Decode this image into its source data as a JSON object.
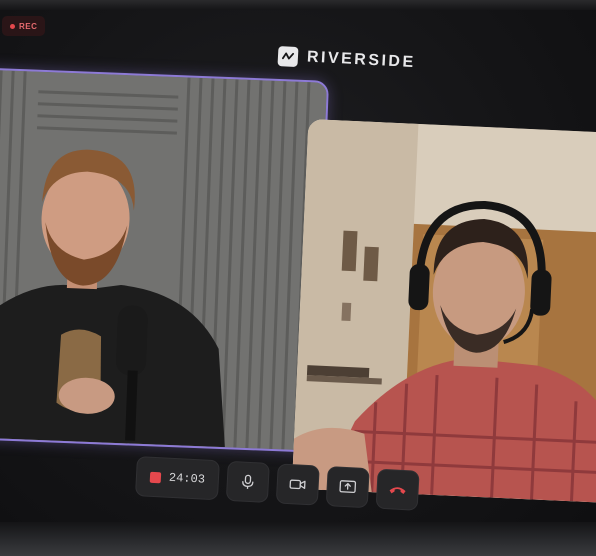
{
  "recording": {
    "badge_label": "REC"
  },
  "brand": {
    "name": "RIVERSIDE"
  },
  "controls": {
    "timer": "24:03",
    "items": [
      {
        "icon": "stop-record-icon"
      },
      {
        "icon": "microphone-icon"
      },
      {
        "icon": "camera-icon"
      },
      {
        "icon": "share-screen-icon"
      },
      {
        "icon": "end-call-icon"
      }
    ]
  },
  "colors": {
    "background": "#151517",
    "active_speaker_border": "#8d7ad6",
    "record": "#e5484d",
    "end_call": "#e5484d",
    "control_bg": "#262628"
  }
}
